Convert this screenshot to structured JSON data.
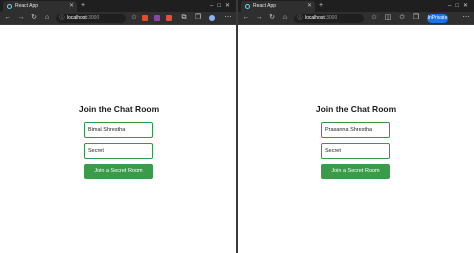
{
  "windows": [
    {
      "tab": {
        "title": "React App"
      },
      "address": {
        "host": "localhost",
        "port": ":3000"
      },
      "page": {
        "heading": "Join the Chat Room",
        "name_value": "Bimal Shrestha",
        "secret_value": "Secret",
        "join_label": "Join a Secret Room"
      }
    },
    {
      "tab": {
        "title": "React App"
      },
      "address": {
        "host": "localhost",
        "port": ":3000"
      },
      "signin_label": "InPrivate",
      "page": {
        "heading": "Join the Chat Room",
        "name_value": "Prasanna Shrestha",
        "secret_value": "Secret",
        "join_label": "Join a Secret Room"
      }
    }
  ],
  "icons": {
    "back": "back-arrow-icon",
    "forward": "forward-arrow-icon",
    "refresh": "refresh-icon",
    "home": "home-icon",
    "info": "info-icon",
    "favorites": "star-icon",
    "collections": "collections-icon",
    "profile": "profile-icon",
    "more": "more-icon"
  },
  "colors": {
    "accent_green": "#3a9b4a",
    "field_border": "#2e9b48",
    "browser_dark": "#2f2f2f",
    "signin_blue": "#1a73e8"
  }
}
